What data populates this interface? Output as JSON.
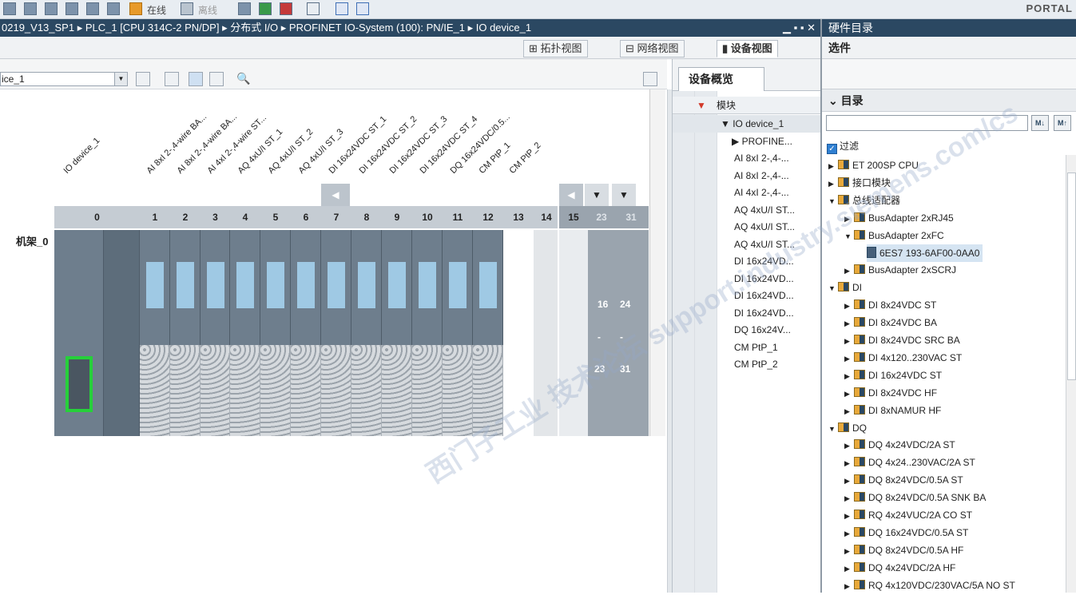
{
  "toolbar": {
    "online_label": "在线",
    "offline_label": "离线",
    "portal": "PORTAL"
  },
  "breadcrumb": {
    "text": "0219_V13_SP1  ▸  PLC_1 [CPU 314C-2 PN/DP]  ▸  分布式 I/O  ▸  PROFINET IO-System (100): PN/IE_1  ▸  IO device_1",
    "controls": "▁ ▪ ▪ ✕"
  },
  "view_tabs": {
    "topology": "拓扑视图",
    "network": "网络视图",
    "device": "设备视图"
  },
  "device_select": {
    "value": "ice_1"
  },
  "rack": {
    "label": "机架_0",
    "slots": [
      "0",
      "1",
      "2",
      "3",
      "4",
      "5",
      "6",
      "7",
      "8",
      "9",
      "10",
      "11",
      "12",
      "13",
      "14",
      "15",
      "23",
      "31"
    ],
    "module_labels": [
      "IO device_1",
      "AI 8xI 2-,4-wire BA...",
      "AI 8xI 2-,4-wire BA...",
      "AI 4xI 2-,4-wire ST...",
      "AQ 4xU/I ST_1",
      "AQ 4xU/I ST_2",
      "AQ 4xU/I ST_3",
      "DI 16x24VDC ST_1",
      "DI 16x24VDC ST_2",
      "DI 16x24VDC ST_3",
      "DI 16x24VDC ST_4",
      "DQ 16x24VDC/0.5...",
      "CM PtP_1",
      "CM PtP_2"
    ],
    "extra_nums": [
      "16",
      "24",
      "23",
      "31",
      "-",
      "-"
    ]
  },
  "overview": {
    "tab": "设备概览",
    "header": "模块",
    "rows": [
      "IO device_1",
      "PROFINE...",
      "AI 8xI 2-,4-...",
      "AI 8xI 2-,4-...",
      "AI 4xI 2-,4-...",
      "AQ 4xU/I ST...",
      "AQ 4xU/I ST...",
      "AQ 4xU/I ST...",
      "DI 16x24VD...",
      "DI 16x24VD...",
      "DI 16x24VD...",
      "DI 16x24VD...",
      "DQ 16x24V...",
      "CM PtP_1",
      "CM PtP_2"
    ]
  },
  "catalog": {
    "title": "硬件目录",
    "options": "选件",
    "section": "目录",
    "filter_label": "过滤",
    "tree": [
      {
        "label": "ET 200SP CPU",
        "level": 0,
        "icon": "folder",
        "expanded": false
      },
      {
        "label": "接口模块",
        "level": 0,
        "icon": "folder",
        "expanded": false
      },
      {
        "label": "总线适配器",
        "level": 0,
        "icon": "folder",
        "expanded": true
      },
      {
        "label": "BusAdapter 2xRJ45",
        "level": 1,
        "icon": "folder",
        "expanded": false
      },
      {
        "label": "BusAdapter 2xFC",
        "level": 1,
        "icon": "folder",
        "expanded": true
      },
      {
        "label": "6ES7 193-6AF00-0AA0",
        "level": 2,
        "icon": "module",
        "selected": true
      },
      {
        "label": "BusAdapter 2xSCRJ",
        "level": 1,
        "icon": "folder",
        "expanded": false
      },
      {
        "label": "DI",
        "level": 0,
        "icon": "folder",
        "expanded": true
      },
      {
        "label": "DI 8x24VDC ST",
        "level": 1,
        "icon": "folder",
        "expanded": false
      },
      {
        "label": "DI 8x24VDC BA",
        "level": 1,
        "icon": "folder",
        "expanded": false
      },
      {
        "label": "DI 8x24VDC SRC BA",
        "level": 1,
        "icon": "folder",
        "expanded": false
      },
      {
        "label": "DI 4x120..230VAC ST",
        "level": 1,
        "icon": "folder",
        "expanded": false
      },
      {
        "label": "DI 16x24VDC ST",
        "level": 1,
        "icon": "folder",
        "expanded": false
      },
      {
        "label": "DI 8x24VDC HF",
        "level": 1,
        "icon": "folder",
        "expanded": false
      },
      {
        "label": "DI 8xNAMUR HF",
        "level": 1,
        "icon": "folder",
        "expanded": false
      },
      {
        "label": "DQ",
        "level": 0,
        "icon": "folder",
        "expanded": true
      },
      {
        "label": "DQ 4x24VDC/2A ST",
        "level": 1,
        "icon": "folder",
        "expanded": false
      },
      {
        "label": "DQ 4x24..230VAC/2A ST",
        "level": 1,
        "icon": "folder",
        "expanded": false
      },
      {
        "label": "DQ 8x24VDC/0.5A ST",
        "level": 1,
        "icon": "folder",
        "expanded": false
      },
      {
        "label": "DQ 8x24VDC/0.5A SNK BA",
        "level": 1,
        "icon": "folder",
        "expanded": false
      },
      {
        "label": "RQ 4x24VUC/2A CO ST",
        "level": 1,
        "icon": "folder",
        "expanded": false
      },
      {
        "label": "DQ 16x24VDC/0.5A ST",
        "level": 1,
        "icon": "folder",
        "expanded": false
      },
      {
        "label": "DQ 8x24VDC/0.5A HF",
        "level": 1,
        "icon": "folder",
        "expanded": false
      },
      {
        "label": "DQ 4x24VDC/2A HF",
        "level": 1,
        "icon": "folder",
        "expanded": false
      },
      {
        "label": "RQ 4x120VDC/230VAC/5A NO ST",
        "level": 1,
        "icon": "folder",
        "expanded": false
      }
    ]
  },
  "watermark": "西门子工业 技术论坛 support.industry.siemens.com/cs"
}
